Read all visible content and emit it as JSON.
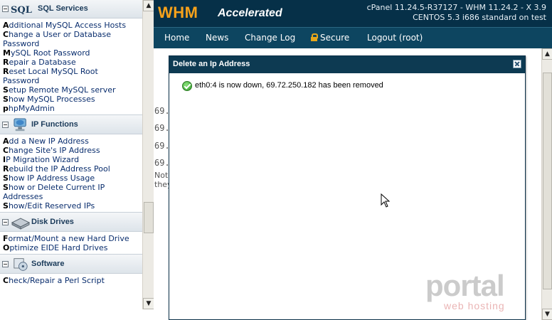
{
  "sidebar": {
    "mysql": {
      "title": "SQL Services",
      "links": [
        {
          "first": "A",
          "rest": "dditional MySQL Access Hosts"
        },
        {
          "first": "C",
          "rest": "hange a User or Database"
        },
        {
          "first": "",
          "rest": "Password"
        },
        {
          "first": "M",
          "rest": "ySQL Root Password"
        },
        {
          "first": "R",
          "rest": "epair a Database"
        },
        {
          "first": "R",
          "rest": "eset Local MySQL Root"
        },
        {
          "first": "",
          "rest": "Password"
        },
        {
          "first": "S",
          "rest": "etup Remote MySQL server"
        },
        {
          "first": "S",
          "rest": "how MySQL Processes"
        },
        {
          "first": "p",
          "rest": "hpMyAdmin"
        }
      ]
    },
    "ip": {
      "title": "IP Functions",
      "links": [
        {
          "first": "A",
          "rest": "dd a New IP Address"
        },
        {
          "first": "C",
          "rest": "hange Site's IP Address"
        },
        {
          "first": "I",
          "rest": "P Migration Wizard"
        },
        {
          "first": "R",
          "rest": "ebuild the IP Address Pool"
        },
        {
          "first": "S",
          "rest": "how IP Address Usage"
        },
        {
          "first": "S",
          "rest": "how or Delete Current IP"
        },
        {
          "first": "",
          "rest": "Addresses"
        },
        {
          "first": "S",
          "rest": "how/Edit Reserved IPs"
        }
      ]
    },
    "disk": {
      "title": "Disk Drives",
      "links": [
        {
          "first": "F",
          "rest": "ormat/Mount a new Hard Drive"
        },
        {
          "first": "O",
          "rest": "ptimize EIDE Hard Drives"
        }
      ]
    },
    "software": {
      "title": "Software",
      "links": [
        {
          "first": "C",
          "rest": "heck/Repair a Perl Script"
        }
      ]
    }
  },
  "header": {
    "logo_main": "WHM",
    "logo_sub": "Accelerated",
    "version_line1": "cPanel 11.24.5-R37127 - WHM 11.24.2 - X 3.9",
    "version_line2": "CENTOS 5.3 i686 standard on test"
  },
  "nav": {
    "items": [
      "Home",
      "News",
      "Change Log",
      "Secure",
      "Logout (root)"
    ]
  },
  "background": {
    "ip_fragments": [
      "69.",
      "69.",
      "69.",
      "69."
    ],
    "note_line1": "Note",
    "note_line2": "they"
  },
  "dialog": {
    "title": "Delete an Ip Address",
    "message": "eth0:4 is now down, 69.72.250.182 has been removed"
  },
  "watermark": {
    "main": "portal",
    "sub": "web hosting"
  },
  "colors": {
    "header_bg": "#063048",
    "nav_bg": "#0d4560",
    "logo_orange": "#f6a21b",
    "link_blue": "#0a2e6e",
    "dialog_title_bg": "#0d3a52",
    "success_green": "#2f9c2a"
  },
  "icons": {
    "mysql": "sql-logo-icon",
    "ip": "network-globe-icon",
    "disk": "hard-drive-icon",
    "software": "software-package-icon",
    "secure": "lock-icon",
    "close": "close-icon",
    "success": "check-circle-icon"
  }
}
